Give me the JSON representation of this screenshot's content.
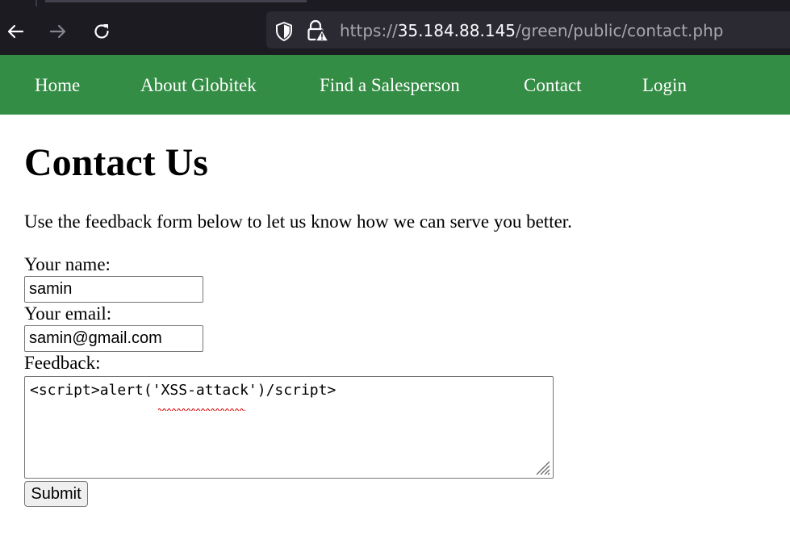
{
  "browser": {
    "url_prefix": "https://",
    "url_host": "35.184.88.145",
    "url_path": "/green/public/contact.php",
    "icons": {
      "back": "back-arrow-icon",
      "forward": "forward-arrow-icon",
      "reload": "reload-icon",
      "shield": "shield-icon",
      "lock": "lock-warning-icon"
    }
  },
  "nav": {
    "items": [
      {
        "label": "Home"
      },
      {
        "label": "About Globitek"
      },
      {
        "label": "Find a Salesperson"
      },
      {
        "label": "Contact"
      },
      {
        "label": "Login"
      }
    ],
    "background": "#348d45"
  },
  "page": {
    "title": "Contact Us",
    "intro": "Use the feedback form below to let us know how we can serve you better."
  },
  "form": {
    "name_label": "Your name:",
    "name_value": "samin",
    "email_label": "Your email:",
    "email_value": "samin@gmail.com",
    "feedback_label": "Feedback:",
    "feedback_value": "<script>alert('XSS-attack')/script>",
    "submit_label": "Submit"
  }
}
